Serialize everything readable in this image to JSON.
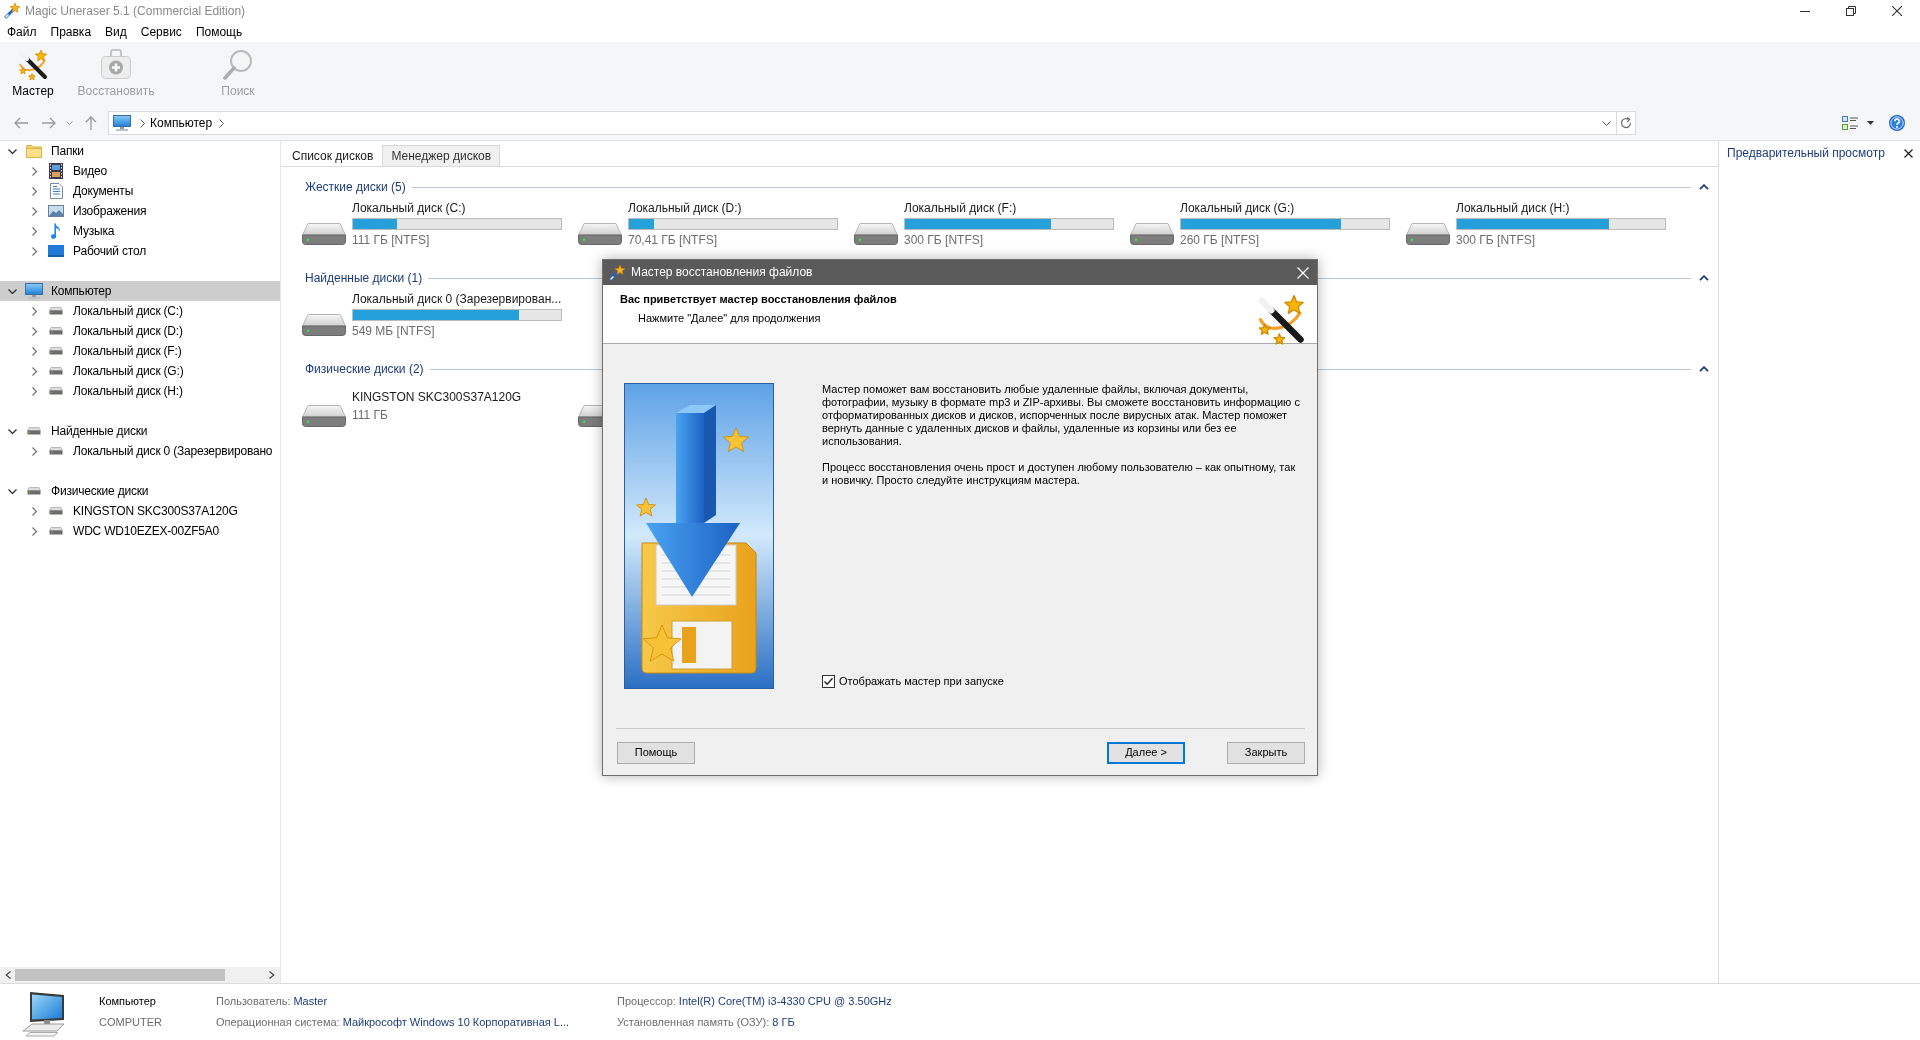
{
  "window": {
    "title": "Magic Uneraser 5.1 (Commercial Edition)"
  },
  "menu": [
    "Файл",
    "Правка",
    "Вид",
    "Сервис",
    "Помощь"
  ],
  "toolbar": [
    {
      "label": "Мастер",
      "kind": "wizard",
      "disabled": false
    },
    {
      "label": "Восстановить",
      "kind": "recover",
      "disabled": true
    },
    {
      "label": "Поиск",
      "kind": "search",
      "disabled": true
    }
  ],
  "address_bar": {
    "path": [
      "Компьютер"
    ]
  },
  "sidebar": {
    "items": [
      {
        "label": "Папки",
        "kind": "folder",
        "expanded": true,
        "selected": false,
        "children": [
          {
            "label": "Видео",
            "kind": "video",
            "expanded": false,
            "selected": false
          },
          {
            "label": "Документы",
            "kind": "documents",
            "expanded": false,
            "selected": false
          },
          {
            "label": "Изображения",
            "kind": "pictures",
            "expanded": false,
            "selected": false
          },
          {
            "label": "Музыка",
            "kind": "music",
            "expanded": false,
            "selected": false
          },
          {
            "label": "Рабочий стол",
            "kind": "desktop",
            "expanded": false,
            "selected": false
          }
        ]
      },
      {
        "label": "Компьютер",
        "kind": "computer",
        "expanded": true,
        "selected": true,
        "children": [
          {
            "label": "Локальный диск (C:)",
            "kind": "drive",
            "expanded": false,
            "selected": false
          },
          {
            "label": "Локальный диск (D:)",
            "kind": "drive",
            "expanded": false,
            "selected": false
          },
          {
            "label": "Локальный диск (F:)",
            "kind": "drive",
            "expanded": false,
            "selected": false
          },
          {
            "label": "Локальный диск (G:)",
            "kind": "drive",
            "expanded": false,
            "selected": false
          },
          {
            "label": "Локальный диск (H:)",
            "kind": "drive",
            "expanded": false,
            "selected": false
          }
        ]
      },
      {
        "label": "Найденные диски",
        "kind": "drive",
        "expanded": true,
        "selected": false,
        "children": [
          {
            "label": "Локальный диск 0 (Зарезервировано",
            "kind": "drive",
            "expanded": false,
            "selected": false
          }
        ]
      },
      {
        "label": "Физические диски",
        "kind": "drive",
        "expanded": true,
        "selected": false,
        "children": [
          {
            "label": "KINGSTON SKC300S37A120G",
            "kind": "drive",
            "expanded": false,
            "selected": false
          },
          {
            "label": "WDC WD10EZEX-00ZF5A0",
            "kind": "drive",
            "expanded": false,
            "selected": false
          }
        ]
      }
    ]
  },
  "tabs": [
    {
      "label": "Список дисков",
      "selected": true
    },
    {
      "label": "Менеджер дисков",
      "selected": false
    }
  ],
  "disk_groups": [
    {
      "title": "Жесткие диски (5)",
      "expanded": true,
      "disks": [
        {
          "kind": "drive",
          "name": "Локальный диск (C:)",
          "level": 0.21,
          "size": "111 ГБ [NTFS]"
        },
        {
          "kind": "drive",
          "name": "Локальный диск (D:)",
          "level": 0.12,
          "size": "70,41 ГБ [NTFS]"
        },
        {
          "kind": "drive",
          "name": "Локальный диск (F:)",
          "level": 0.7,
          "size": "300 ГБ [NTFS]"
        },
        {
          "kind": "drive",
          "name": "Локальный диск (G:)",
          "level": 0.77,
          "size": "260 ГБ [NTFS]"
        },
        {
          "kind": "drive",
          "name": "Локальный диск (H:)",
          "level": 0.73,
          "size": "300 ГБ [NTFS]"
        }
      ]
    },
    {
      "title": "Найденные диски (1)",
      "expanded": true,
      "disks": [
        {
          "kind": "drive",
          "name": "Локальный диск 0 (Зарезервирован...",
          "level": 0.8,
          "size": "549 МБ [NTFS]"
        }
      ]
    },
    {
      "title": "Физические диски (2)",
      "expanded": true,
      "disks": [
        {
          "kind": "drive",
          "name": "KINGSTON SKC300S37A120G",
          "size": "111 ГБ"
        },
        {
          "kind": "drive"
        }
      ]
    }
  ],
  "preview": {
    "title": "Предварительный просмотр"
  },
  "status_bar": {
    "computer": "Компьютер",
    "host": "COMPUTER",
    "fields": [
      {
        "label": "Пользователь:",
        "value": "Master"
      },
      {
        "label": "Операционная система:",
        "value": "Майкрософт Windows 10 Корпоративная L..."
      },
      {
        "label": "Процессор:",
        "value": "Intel(R) Core(TM) i3-4330 CPU @ 3.50GHz"
      },
      {
        "label": "Установленная память (ОЗУ):",
        "value": "8 ГБ"
      }
    ]
  },
  "dialog": {
    "title": "Мастер восстановления файлов",
    "heading": "Вас приветствует мастер восстановления файлов",
    "subheading": "Нажмите \"Далее\" для продолжения",
    "paragraphs": [
      "Мастер поможет вам восстановить любые удаленные файлы, включая документы, фотографии, музыку в формате mp3 и ZIP-архивы. Вы сможете восстановить информацию с отформатированных дисков и дисков, испорченных после вирусных атак. Мастер поможет вернуть данные с удаленных дисков и файлы, удаленные из корзины или без ее использования.",
      "Процесс восстановления очень прост и доступен любому пользователю – как опытному, так и новичку. Просто следуйте инструкциям мастера."
    ],
    "checkbox": {
      "label": "Отображать мастер при запуске",
      "checked": true
    },
    "buttons": [
      {
        "label": "Помощь",
        "default": false
      },
      {
        "label": "Далее >",
        "default": true
      },
      {
        "label": "Закрыть",
        "default": false
      }
    ]
  }
}
